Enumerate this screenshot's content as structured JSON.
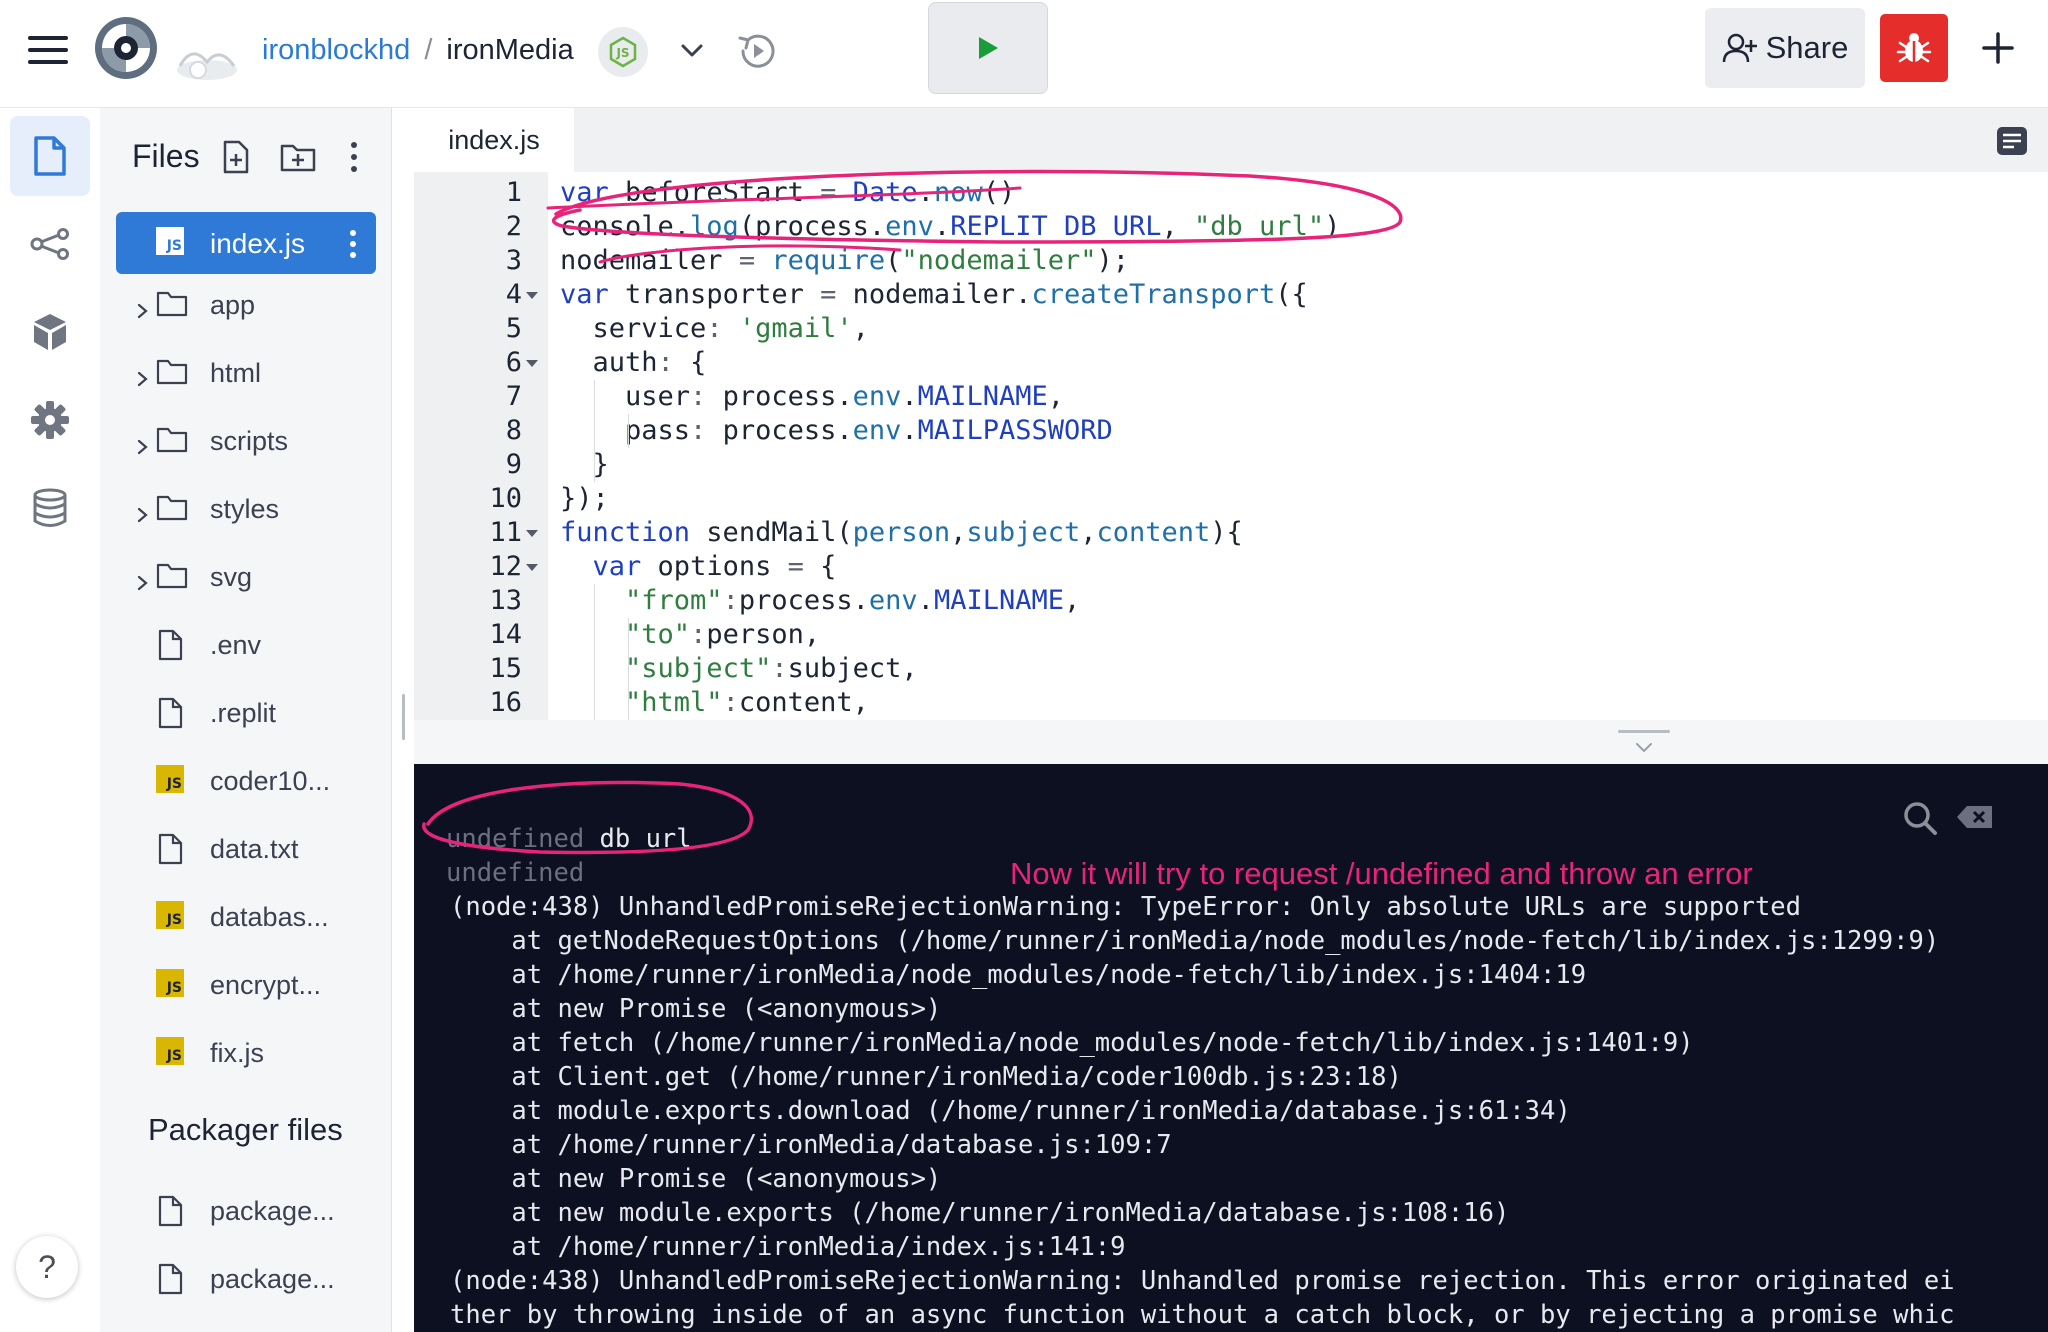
{
  "header": {
    "user": "ironblockhd",
    "separator": "/",
    "project": "ironMedia",
    "share_label": "Share"
  },
  "sidebar": {
    "title": "Files",
    "selected_file": "index.js",
    "items": [
      {
        "name": "app",
        "type": "folder"
      },
      {
        "name": "html",
        "type": "folder"
      },
      {
        "name": "scripts",
        "type": "folder"
      },
      {
        "name": "styles",
        "type": "folder"
      },
      {
        "name": "svg",
        "type": "folder"
      },
      {
        "name": ".env",
        "type": "file"
      },
      {
        "name": ".replit",
        "type": "file"
      },
      {
        "name": "coder10...",
        "type": "js"
      },
      {
        "name": "data.txt",
        "type": "file"
      },
      {
        "name": "databas...",
        "type": "js"
      },
      {
        "name": "encrypt...",
        "type": "js"
      },
      {
        "name": "fix.js",
        "type": "js"
      }
    ],
    "packager_title": "Packager files",
    "packager_items": [
      {
        "name": "package...",
        "type": "file"
      },
      {
        "name": "package...",
        "type": "file"
      }
    ],
    "js_badge": "JS",
    "help_label": "?"
  },
  "editor": {
    "tab_label": "index.js",
    "line_numbers": [
      "1",
      "2",
      "3",
      "4",
      "5",
      "6",
      "7",
      "8",
      "9",
      "10",
      "11",
      "12",
      "13",
      "14",
      "15",
      "16"
    ],
    "lines": [
      [
        [
          "kw",
          "var"
        ],
        [
          "id",
          " beforeStart "
        ],
        [
          "op",
          "="
        ],
        [
          "id",
          " "
        ],
        [
          "cn",
          "Date"
        ],
        [
          "id",
          "."
        ],
        [
          "pr",
          "now"
        ],
        [
          "id",
          "()"
        ]
      ],
      [
        [
          "id",
          "console."
        ],
        [
          "pr",
          "log"
        ],
        [
          "id",
          "(process."
        ],
        [
          "pr",
          "env"
        ],
        [
          "id",
          "."
        ],
        [
          "cn",
          "REPLIT_DB_URL"
        ],
        [
          "id",
          ", "
        ],
        [
          "st",
          "\"db url\""
        ],
        [
          "id",
          ")"
        ]
      ],
      [
        [
          "id",
          "nodemailer "
        ],
        [
          "op",
          "="
        ],
        [
          "id",
          " "
        ],
        [
          "pr",
          "require"
        ],
        [
          "id",
          "("
        ],
        [
          "st",
          "\"nodemailer\""
        ],
        [
          "id",
          ");"
        ]
      ],
      [
        [
          "kw",
          "var"
        ],
        [
          "id",
          " transporter "
        ],
        [
          "op",
          "="
        ],
        [
          "id",
          " nodemailer."
        ],
        [
          "pr",
          "createTransport"
        ],
        [
          "id",
          "({"
        ]
      ],
      [
        [
          "id",
          "  service"
        ],
        [
          "op",
          ":"
        ],
        [
          "id",
          " "
        ],
        [
          "st",
          "'gmail'"
        ],
        [
          "id",
          ","
        ]
      ],
      [
        [
          "id",
          "  auth"
        ],
        [
          "op",
          ":"
        ],
        [
          "id",
          " {"
        ]
      ],
      [
        [
          "id",
          "    user"
        ],
        [
          "op",
          ":"
        ],
        [
          "id",
          " process."
        ],
        [
          "pr",
          "env"
        ],
        [
          "id",
          "."
        ],
        [
          "cn",
          "MAILNAME"
        ],
        [
          "id",
          ","
        ]
      ],
      [
        [
          "id",
          "    pass"
        ],
        [
          "op",
          ":"
        ],
        [
          "id",
          " process."
        ],
        [
          "pr",
          "env"
        ],
        [
          "id",
          "."
        ],
        [
          "cn",
          "MAILPASSWORD"
        ]
      ],
      [
        [
          "id",
          "  }"
        ]
      ],
      [
        [
          "id",
          "});"
        ]
      ],
      [
        [
          "kw",
          "function"
        ],
        [
          "id",
          " sendMail("
        ],
        [
          "ar",
          "person"
        ],
        [
          "id",
          ","
        ],
        [
          "ar",
          "subject"
        ],
        [
          "id",
          ","
        ],
        [
          "ar",
          "content"
        ],
        [
          "id",
          "){"
        ]
      ],
      [
        [
          "id",
          "  "
        ],
        [
          "kw",
          "var"
        ],
        [
          "id",
          " options "
        ],
        [
          "op",
          "="
        ],
        [
          "id",
          " {"
        ]
      ],
      [
        [
          "id",
          "    "
        ],
        [
          "st",
          "\"from\""
        ],
        [
          "op",
          ":"
        ],
        [
          "id",
          "process."
        ],
        [
          "pr",
          "env"
        ],
        [
          "id",
          "."
        ],
        [
          "cn",
          "MAILNAME"
        ],
        [
          "id",
          ","
        ]
      ],
      [
        [
          "id",
          "    "
        ],
        [
          "st",
          "\"to\""
        ],
        [
          "op",
          ":"
        ],
        [
          "id",
          "person,"
        ]
      ],
      [
        [
          "id",
          "    "
        ],
        [
          "st",
          "\"subject\""
        ],
        [
          "op",
          ":"
        ],
        [
          "id",
          "subject,"
        ]
      ],
      [
        [
          "id",
          "    "
        ],
        [
          "st",
          "\"html\""
        ],
        [
          "op",
          ":"
        ],
        [
          "id",
          "content,"
        ]
      ]
    ]
  },
  "console": {
    "lines": [
      {
        "text": "undefined",
        "extra": " db url",
        "dim": true
      },
      {
        "text": "undefined",
        "dim": true
      },
      {
        "text": "(node:438) UnhandledPromiseRejectionWarning: TypeError: Only absolute URLs are supported"
      },
      {
        "text": "    at getNodeRequestOptions (/home/runner/ironMedia/node_modules/node-fetch/lib/index.js:1299:9)"
      },
      {
        "text": "    at /home/runner/ironMedia/node_modules/node-fetch/lib/index.js:1404:19"
      },
      {
        "text": "    at new Promise (<anonymous>)"
      },
      {
        "text": "    at fetch (/home/runner/ironMedia/node_modules/node-fetch/lib/index.js:1401:9)"
      },
      {
        "text": "    at Client.get (/home/runner/ironMedia/coder100db.js:23:18)"
      },
      {
        "text": "    at module.exports.download (/home/runner/ironMedia/database.js:61:34)"
      },
      {
        "text": "    at /home/runner/ironMedia/database.js:109:7"
      },
      {
        "text": "    at new Promise (<anonymous>)"
      },
      {
        "text": "    at new module.exports (/home/runner/ironMedia/database.js:108:16)"
      },
      {
        "text": "    at /home/runner/ironMedia/index.js:141:9"
      },
      {
        "text": "(node:438) UnhandledPromiseRejectionWarning: Unhandled promise rejection. This error originated ei"
      },
      {
        "text": "ther by throwing inside of an async function without a catch block, or by rejecting a promise whic"
      }
    ]
  },
  "annotation": {
    "text": "Now it will try to request /undefined and throw an error",
    "color": "#e8247a"
  },
  "colors": {
    "accent": "#2e7ad6",
    "run_green": "#1a9c3a",
    "debug_red": "#e52e2b",
    "console_bg": "#0d1021"
  }
}
